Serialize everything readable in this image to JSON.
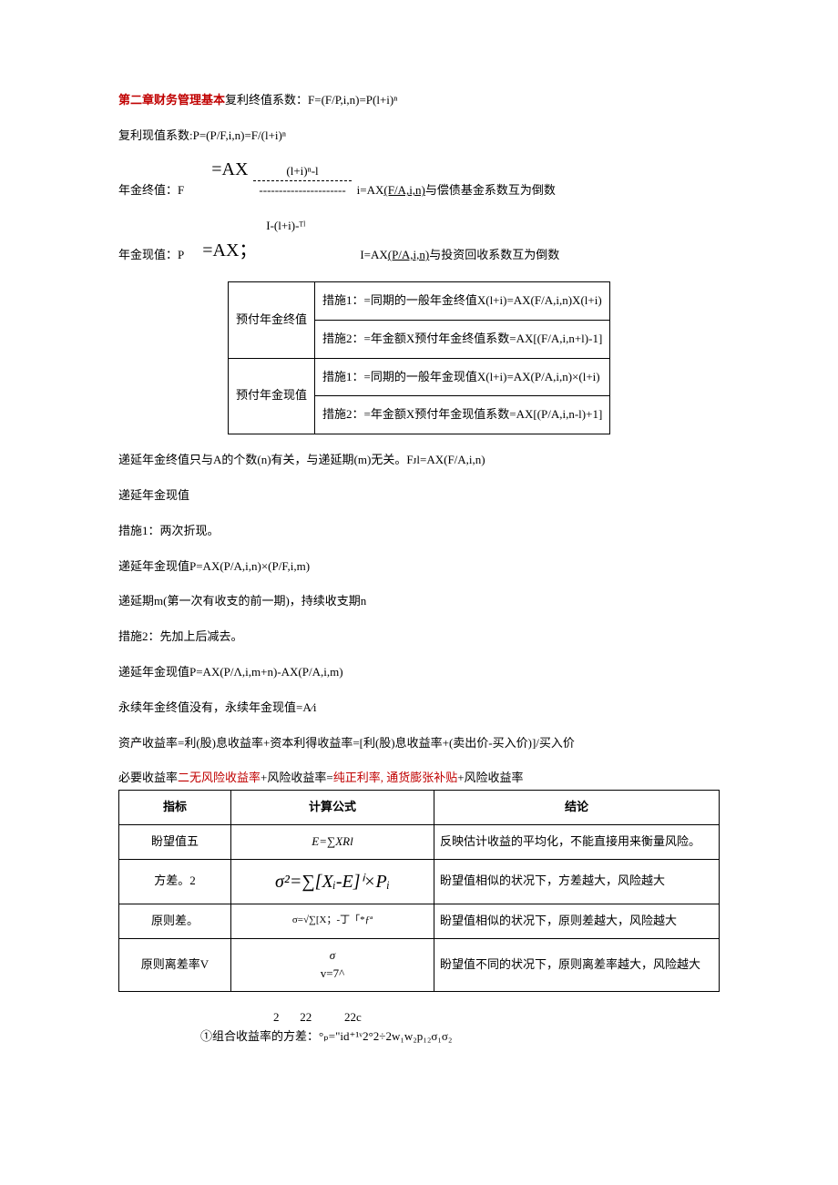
{
  "title_prefix": "第二章财务管理基本",
  "fv_factor": "复利终值系数：F=(F/P,i,n)=P(l+i)ⁿ",
  "pv_factor": "复利现值系数:P=(P/F,i,n)=F/(l+i)ⁿ",
  "annuity_fv_label": "年金终值：F",
  "annuity_fv_eq": "=AX",
  "annuity_fv_num": "(l+i)ⁿ-l",
  "annuity_fv_dash": "----------------------",
  "annuity_fv_tail1": "i=AX",
  "annuity_fv_tail_u": "(F/A,i,n)",
  "annuity_fv_tail2": "与偿债基金系数互为倒数",
  "annuity_pv_label": "年金现值：P",
  "annuity_pv_eq": "=AX；",
  "annuity_pv_num": "I-(l+i)-ᵀˡ",
  "annuity_pv_tail1": "I=AX",
  "annuity_pv_tail_u": "(P/A,i,n)",
  "annuity_pv_tail2": "与投资回收系数互为倒数",
  "table1": {
    "r1c1": "预付年金终值",
    "r1c2": "措施1：=同期的一般年金终值X(l+i)=AX(F/A,i,n)X(l+i)",
    "r2c2": "措施2：=年金额X预付年金终值系数=AX[(F/A,i,n+l)-1]",
    "r3c1": "预付年金现值",
    "r3c2": "措施1：=同期的一般年金现值X(l+i)=AX(P/A,i,n)×(l+i)",
    "r4c2": "措施2：=年金额X预付年金现值系数=AX[(P/A,i,n-l)+1]"
  },
  "p_defer_fv": "递延年金终值只与A的个数(n)有关，与递延期(m)无关。Fᴊl=AX(F/A,i,n)",
  "p_defer_pv": "递延年金现值",
  "p_m1": "措施1：两次折现。",
  "p_m1_formula": "递延年金现值P=AX(P/A,i,n)×(P/F,i,m)",
  "p_defer_period": "递延期m(第一次有收支的前一期)，持续收支期n",
  "p_m2": "措施2：先加上后减去。",
  "p_m2_formula": "递延年金现值P=AX(P/Λ,i,m+n)-AX(P/A,i,m)",
  "p_perpetual": "永续年金终值没有，永续年金现值=A∕i",
  "p_return": "资产收益率=利(股)息收益率+资本利得收益率=[利(股)息收益率+(卖出价-买入价)]/买入价",
  "p_required_1": "必要收益率",
  "p_required_red1": "二无风险收益率",
  "p_required_2": "+风险收益率=",
  "p_required_red2": "纯正利率, 通货膨张补贴",
  "p_required_3": "+风险收益率",
  "table2": {
    "h1": "指标",
    "h2": "计算公式",
    "h3": "结论",
    "r1c1": "盼望值五",
    "r1c2": "E=∑XRl",
    "r1c3": "反映估计收益的平均化，不能直接用来衡量风险。",
    "r2c1": "方差。2",
    "r2c2": "σ²=∑[Xᵢ-E]ⁱ×Pᵢ",
    "r2c3": "盼望值相似的状况下，方差越大，风险越大",
    "r3c1": "原则差。",
    "r3c2": "σ=√∑[X；-丁「*ƒª",
    "r3c3": "盼望值相似的状况下，原则差越大，风险越大",
    "r4c1": "原则离差率V",
    "r4c2_a": "σ",
    "r4c2_b": "v=7^",
    "r4c3": "盼望值不同的状况下，原则离差率越大，风险越大"
  },
  "portfolio_sup": "2       22           22c",
  "portfolio_label": "①组合收益率的方差：",
  "portfolio_formula": "°ₚ=\"id⁺¹ᵛ2°2÷2w₁w₂p₁₂σ₁σ₂"
}
